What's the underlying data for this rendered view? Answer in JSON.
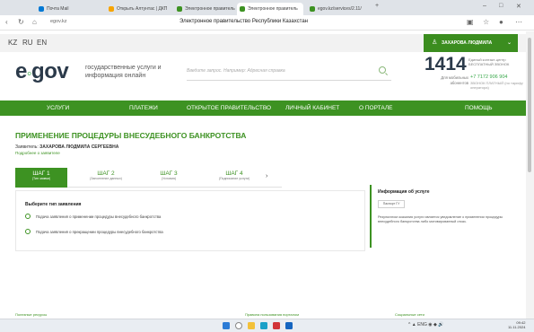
{
  "browser": {
    "tabs": [
      {
        "label": "Почта Mail",
        "color": "#0078d4"
      },
      {
        "label": "Открыть Алтунтас | ДКП",
        "color": "#f7a400"
      },
      {
        "label": "Электронное правитель",
        "color": "#3d9222"
      },
      {
        "label": "Электронное правитель",
        "color": "#3d9222"
      },
      {
        "label": "egov.kz/services/2.11/",
        "color": "#3d9222"
      }
    ],
    "new_tab": "+",
    "url": "egov.kz",
    "page_title": "Электронное правительство Республики Казахстан",
    "window_controls": [
      "–",
      "□",
      "✕"
    ]
  },
  "header": {
    "languages": [
      "KZ",
      "RU",
      "EN"
    ],
    "user_name": "ЗАХАРОВА ЛЮДМИЛА",
    "logo_prefix": "e",
    "logo_suffix": "gov",
    "tagline": "государственные услуги и информация онлайн",
    "search_placeholder": "Введите запрос. Например: Адресная справка",
    "hotline_number": "1414",
    "hotline_sub": "Единый контакт-центр БЕСПЛАТНЫЙ ЗВОНОК",
    "mobile_label": "Для мобильных абонентов",
    "mobile_phone": "+7 7172 906 904",
    "mobile_sub": "ЗВОНОК ПЛАТНЫЙ (по тарифу оператора)"
  },
  "nav": [
    "УСЛУГИ",
    "ПЛАТЕЖИ",
    "ОТКРЫТОЕ ПРАВИТЕЛЬСТВО",
    "ЛИЧНЫЙ КАБИНЕТ",
    "О ПОРТАЛЕ",
    "ПОМОЩЬ"
  ],
  "page": {
    "title": "ПРИМЕНЕНИЕ ПРОЦЕДУРЫ ВНЕСУДЕБНОГО БАНКРОТСТВА",
    "applicant_label": "Заявитель:",
    "applicant_name": "ЗАХАРОВА ЛЮДМИЛА СЕРГЕЕВНА",
    "details_link": "Подробнее о заявителе",
    "steps": [
      {
        "title": "ШАГ 1",
        "sub": "(Тип заявки)"
      },
      {
        "title": "ШАГ 2",
        "sub": "(Заполнение данных)"
      },
      {
        "title": "ШАГ 3",
        "sub": "(Условия)"
      },
      {
        "title": "ШАГ 4",
        "sub": "(Подписание услуги)"
      }
    ],
    "steps_next": "›",
    "choose_label": "Выберите тип заявления",
    "options": [
      "Подача заявления о применении процедуры внесудебного банкротства",
      "Подача заявления о прекращении процедуры внесудебного банкротства"
    ]
  },
  "info": {
    "title": "Информация об услуге",
    "button": "Паспорт ГУ",
    "text": "Результатом оказания услуги является уведомление о применении процедуры внесудебного банкротства либо мотивированный отказ."
  },
  "footer": [
    "Полезные ресурсы",
    "Правила пользования порталом",
    "Социальные сети"
  ],
  "taskbar": {
    "tray": "^  ▲  ENG  ◉ ◆ 🔊",
    "time": "09:42",
    "date": "11.11.2024"
  }
}
